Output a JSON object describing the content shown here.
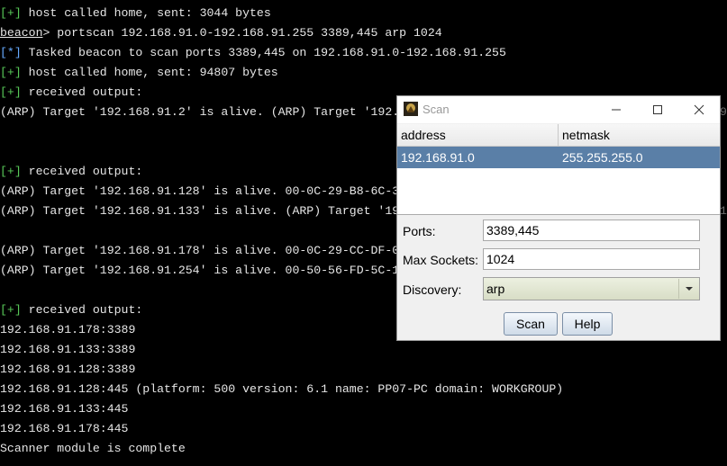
{
  "terminal": {
    "lines": [
      {
        "tag": "[+]",
        "text": " host called home, sent: 3044 bytes"
      },
      {
        "prompt": "beacon",
        "text": "> portscan 192.168.91.0-192.168.91.255 3389,445 arp 1024"
      },
      {
        "tag": "[*]",
        "text": " Tasked beacon to scan ports 3389,445 on 192.168.91.0-192.168.91.255"
      },
      {
        "tag": "[+]",
        "text": " host called home, sent: 94807 bytes"
      },
      {
        "tag": "[+]",
        "text": " received output:"
      },
      {
        "text": "(ARP) Target '192.168.91.2' is alive. (ARP) Target '192.",
        "right": "9"
      },
      {
        "text": ""
      },
      {
        "text": ""
      },
      {
        "tag": "[+]",
        "text": " received output:"
      },
      {
        "text": "(ARP) Target '192.168.91.128' is alive. 00-0C-29-B8-6C-3"
      },
      {
        "text": "(ARP) Target '192.168.91.133' is alive. (ARP) Target '19",
        "right": "1"
      },
      {
        "text": ""
      },
      {
        "text": "(ARP) Target '192.168.91.178' is alive. 00-0C-29-CC-DF-0"
      },
      {
        "text": "(ARP) Target '192.168.91.254' is alive. 00-50-56-FD-5C-1"
      },
      {
        "text": ""
      },
      {
        "tag": "[+]",
        "text": " received output:"
      },
      {
        "text": "192.168.91.178:3389"
      },
      {
        "text": "192.168.91.133:3389"
      },
      {
        "text": "192.168.91.128:3389"
      },
      {
        "text": "192.168.91.128:445 (platform: 500 version: 6.1 name: PP07-PC domain: WORKGROUP)"
      },
      {
        "text": "192.168.91.133:445"
      },
      {
        "text": "192.168.91.178:445"
      },
      {
        "text": "Scanner module is complete"
      }
    ]
  },
  "dialog": {
    "title": "Scan",
    "window_buttons": {
      "minimize": "—",
      "maximize": "☐",
      "close": "✕"
    },
    "table": {
      "columns": [
        "address",
        "netmask"
      ],
      "rows": [
        [
          "192.168.91.0",
          "255.255.255.0"
        ]
      ]
    },
    "ports_label": "Ports:",
    "ports_value": "3389,445",
    "max_sockets_label": "Max Sockets:",
    "max_sockets_value": "1024",
    "discovery_label": "Discovery:",
    "discovery_value": "arp",
    "scan_button": "Scan",
    "help_button": "Help"
  },
  "colors": {
    "terminal_bg": "#000000",
    "terminal_fg": "#e6e6e6",
    "tag_plus": "#58c858",
    "tag_info": "#66aaff",
    "selected_row": "#5a7fa7"
  }
}
